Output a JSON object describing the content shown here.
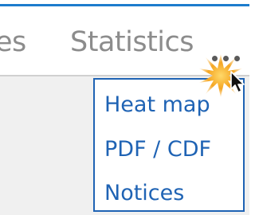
{
  "tabs": [
    {
      "label": "es"
    },
    {
      "label": "Statistics"
    }
  ],
  "overflow": {
    "label": "...",
    "icon": "more-horizontal-icon"
  },
  "menu": {
    "items": [
      {
        "label": "Heat map"
      },
      {
        "label": "PDF / CDF"
      },
      {
        "label": "Notices"
      }
    ]
  },
  "colors": {
    "accent": "#1c7ccd",
    "menu_text": "#1f63b4",
    "tab_text": "#8c8c8c",
    "click_highlight": "#f5a623"
  },
  "cursor": {
    "icon": "mouse-pointer-icon",
    "effect": "click-highlight-burst"
  }
}
